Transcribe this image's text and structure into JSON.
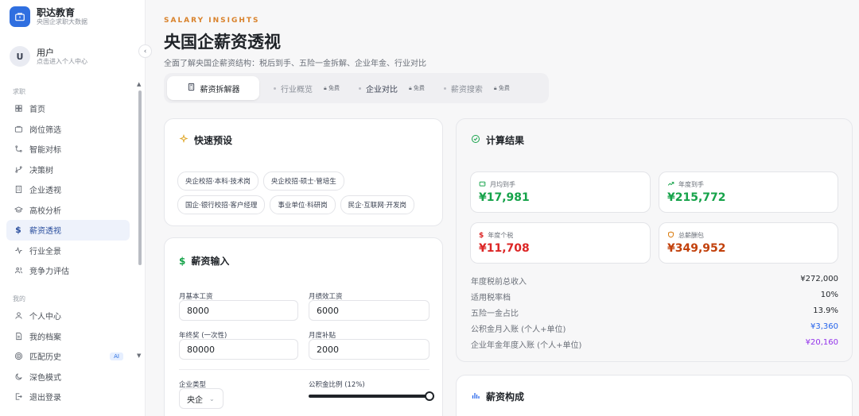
{
  "brand": {
    "title": "职达教育",
    "subtitle": "央国企求职大数据"
  },
  "user": {
    "initial": "U",
    "name": "用户",
    "subtitle": "点击进入个人中心"
  },
  "sidebar": {
    "section1": "求职",
    "items1": [
      {
        "label": "首页",
        "icon": "grid-icon"
      },
      {
        "label": "岗位筛选",
        "icon": "briefcase-icon"
      },
      {
        "label": "智能对标",
        "icon": "compare-icon"
      },
      {
        "label": "决策树",
        "icon": "branch-icon"
      },
      {
        "label": "企业透视",
        "icon": "building-icon"
      },
      {
        "label": "高校分析",
        "icon": "graduation-cap-icon"
      },
      {
        "label": "薪资透视",
        "icon": "dollar-icon",
        "active": true
      },
      {
        "label": "行业全景",
        "icon": "pulse-icon"
      },
      {
        "label": "竞争力评估",
        "icon": "users-icon"
      }
    ],
    "section2": "我的",
    "items2": [
      {
        "label": "个人中心",
        "icon": "user-icon"
      },
      {
        "label": "我的档案",
        "icon": "file-icon"
      },
      {
        "label": "匹配历史",
        "icon": "target-icon",
        "badge": "AI"
      },
      {
        "label": "深色模式",
        "icon": "moon-icon"
      },
      {
        "label": "退出登录",
        "icon": "logout-icon"
      }
    ]
  },
  "header": {
    "eyebrow": "SALARY INSIGHTS",
    "title": "央国企薪资透视",
    "subtitle": "全面了解央国企薪资结构：税后到手、五险一金拆解、企业年金、行业对比"
  },
  "tabs": [
    {
      "label": "薪资拆解器",
      "active": true
    },
    {
      "label": "行业概览",
      "lock": "免费"
    },
    {
      "label": "企业对比",
      "lock": "免费"
    },
    {
      "label": "薪资搜索",
      "lock": "免费"
    }
  ],
  "presets": {
    "title": "快速预设",
    "chips": [
      "央企校招·本科·技术岗",
      "央企校招·硕士·管培生",
      "国企·银行校招·客户经理",
      "事业单位·科研岗",
      "民企·互联网·开发岗"
    ]
  },
  "input": {
    "title": "薪资输入",
    "base_label": "月基本工资",
    "base_value": "8000",
    "perf_label": "月绩效工资",
    "perf_value": "6000",
    "bonus_label": "年终奖 (一次性)",
    "bonus_value": "80000",
    "allow_label": "月度补贴",
    "allow_value": "2000",
    "type_label": "企业类型",
    "type_value": "央企",
    "fund_label": "公积金比例 (12%)",
    "fund_ratio": 0.12
  },
  "result": {
    "title": "计算结果",
    "cards": [
      {
        "label": "月均到手",
        "value": "¥17,981",
        "color": "#16a34a",
        "icon": "wallet-icon"
      },
      {
        "label": "年度到手",
        "value": "¥215,772",
        "color": "#16a34a",
        "icon": "trend-up-icon"
      },
      {
        "label": "年度个税",
        "value": "¥11,708",
        "color": "#dc2626",
        "icon": "dollar-icon"
      },
      {
        "label": "总薪酬包",
        "value": "¥349,952",
        "color": "#c2410c",
        "icon": "shield-icon"
      }
    ],
    "rows": [
      {
        "label": "年度税前总收入",
        "value": "¥272,000",
        "color": "#1f2328"
      },
      {
        "label": "适用税率档",
        "value": "10%",
        "color": "#1f2328"
      },
      {
        "label": "五险一金占比",
        "value": "13.9%",
        "color": "#1f2328"
      },
      {
        "label": "公积金月入账 (个人+单位)",
        "value": "¥3,360",
        "color": "#2563eb"
      },
      {
        "label": "企业年金年度入账 (个人+单位)",
        "value": "¥20,160",
        "color": "#9333ea"
      }
    ]
  },
  "composition": {
    "title": "薪资构成"
  }
}
